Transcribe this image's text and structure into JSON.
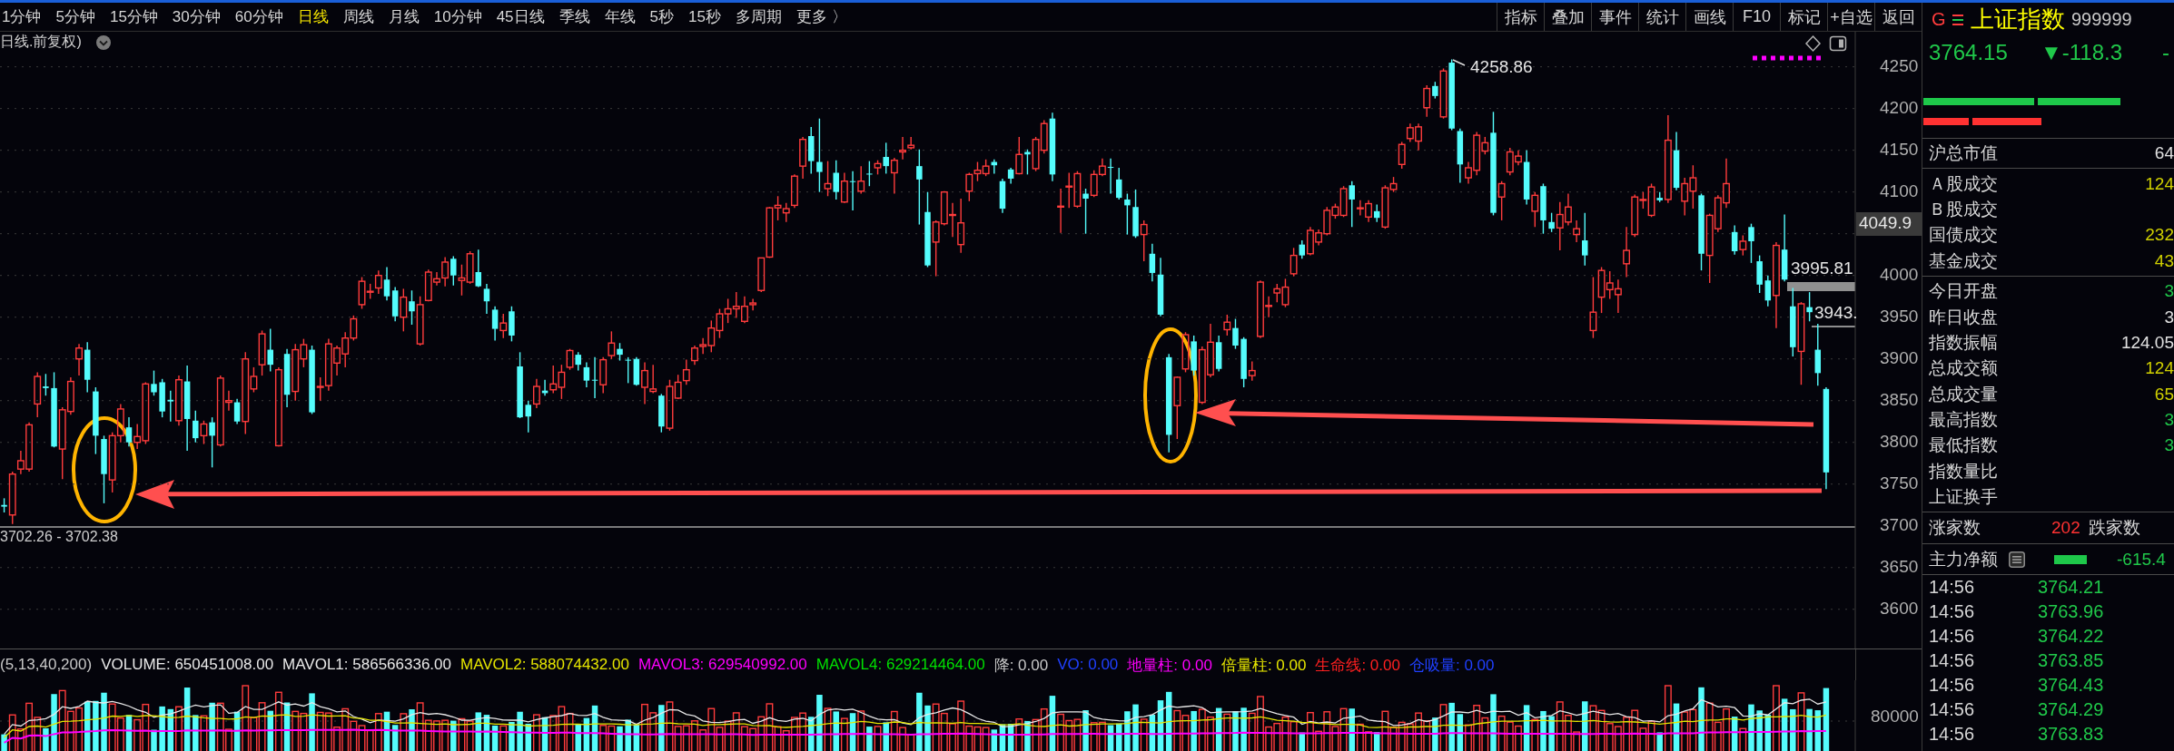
{
  "toolbar": {
    "periods": [
      {
        "label": "1分钟",
        "selected": false
      },
      {
        "label": "5分钟",
        "selected": false
      },
      {
        "label": "15分钟",
        "selected": false
      },
      {
        "label": "30分钟",
        "selected": false
      },
      {
        "label": "60分钟",
        "selected": false
      },
      {
        "label": "日线",
        "selected": true
      },
      {
        "label": "周线",
        "selected": false
      },
      {
        "label": "月线",
        "selected": false
      },
      {
        "label": "10分钟",
        "selected": false
      },
      {
        "label": "45日线",
        "selected": false
      },
      {
        "label": "季线",
        "selected": false
      },
      {
        "label": "年线",
        "selected": false
      },
      {
        "label": "5秒",
        "selected": false
      },
      {
        "label": "15秒",
        "selected": false
      },
      {
        "label": "多周期",
        "selected": false
      },
      {
        "label": "更多 〉",
        "selected": false
      }
    ],
    "tools": [
      "指标",
      "叠加",
      "事件",
      "统计",
      "画线",
      "F10",
      "标记",
      "+自选",
      "返回"
    ]
  },
  "chart": {
    "subtitle": "日线.前复权)",
    "high_label": "4258.86",
    "current_price": "4049.9",
    "price_marks": [
      "3995.81",
      "3943."
    ],
    "low_label": "3702.26 - 3702.38",
    "chart_data": {
      "type": "candlestick",
      "grid": true,
      "ylim": [
        3553,
        4292
      ],
      "yticks": [
        3600,
        3650,
        3700,
        3750,
        3800,
        3850,
        3900,
        3950,
        4000,
        4100,
        4150,
        4200,
        4250
      ],
      "categories": [
        null,
        null,
        null,
        null,
        null,
        null,
        null,
        null,
        null,
        null,
        null,
        null,
        null,
        null,
        null,
        null,
        null,
        null,
        null,
        null,
        null,
        null,
        null,
        null,
        null,
        null,
        null,
        null,
        null,
        null,
        null,
        null,
        null,
        null,
        null,
        null,
        null,
        null,
        null,
        null,
        null,
        null,
        null,
        null,
        null,
        null,
        null,
        null,
        null,
        null,
        null,
        null,
        null,
        null,
        null,
        null,
        null,
        null,
        null,
        null,
        null,
        null,
        null,
        null,
        null,
        null,
        null,
        null,
        null,
        null,
        null,
        null,
        null,
        null,
        null,
        null,
        null,
        null,
        null,
        null,
        null,
        null,
        null,
        null,
        null,
        null,
        null,
        null,
        null,
        null,
        null,
        null,
        null,
        null,
        null,
        null,
        null,
        null,
        null,
        null,
        null,
        null,
        null,
        null,
        null,
        null,
        null,
        null,
        null,
        null,
        null,
        null,
        null,
        null,
        null,
        null,
        null,
        null,
        null,
        null,
        null,
        null,
        null,
        null,
        null,
        null,
        null,
        null,
        null,
        null,
        null,
        null,
        null,
        null,
        null,
        null,
        null,
        null,
        null,
        null,
        null,
        null,
        null,
        null,
        null,
        null,
        null,
        null,
        null,
        null,
        null,
        null,
        null,
        null,
        null,
        null,
        null,
        null,
        null,
        null,
        null,
        null,
        null,
        null,
        null,
        null,
        null,
        null,
        null,
        null,
        null,
        null,
        null,
        null,
        null,
        null,
        null,
        null,
        null,
        null,
        null,
        null,
        null,
        null,
        null,
        null,
        null,
        null,
        null,
        null,
        null,
        null,
        null,
        null,
        null,
        null,
        null,
        null,
        null,
        null,
        null,
        null,
        null,
        null,
        null,
        null,
        null,
        null,
        null,
        null,
        null,
        null,
        null,
        null,
        null,
        null,
        null,
        null,
        null,
        null,
        null,
        null,
        null
      ],
      "ohlc": [
        [
          3725,
          3733,
          3716,
          3723
        ],
        [
          3713,
          3765,
          3702.26,
          3762
        ],
        [
          3768,
          3790,
          3762,
          3778
        ],
        [
          3768,
          3824,
          3765,
          3821
        ],
        [
          3846,
          3884,
          3830,
          3879
        ],
        [
          3867,
          3882,
          3856,
          3865
        ],
        [
          3865,
          3884,
          3794,
          3795
        ],
        [
          3792,
          3842,
          3756,
          3839
        ],
        [
          3837,
          3878,
          3833,
          3873
        ],
        [
          3900,
          3918,
          3880,
          3913
        ],
        [
          3911,
          3920,
          3860,
          3875
        ],
        [
          3861,
          3866,
          3786,
          3808
        ],
        [
          3804,
          3808,
          3727,
          3762
        ],
        [
          3755,
          3812,
          3740,
          3808
        ],
        [
          3808,
          3846,
          3800,
          3840
        ],
        [
          3818,
          3830,
          3795,
          3800
        ],
        [
          3800,
          3822,
          3792,
          3807
        ],
        [
          3802,
          3872,
          3798,
          3870
        ],
        [
          3870,
          3886,
          3856,
          3860
        ],
        [
          3872,
          3876,
          3830,
          3837
        ],
        [
          3851,
          3862,
          3825,
          3849
        ],
        [
          3826,
          3880,
          3820,
          3875
        ],
        [
          3873,
          3892,
          3790,
          3828
        ],
        [
          3826,
          3838,
          3800,
          3805
        ],
        [
          3808,
          3826,
          3798,
          3822
        ],
        [
          3824,
          3830,
          3770,
          3808
        ],
        [
          3797,
          3880,
          3795,
          3877
        ],
        [
          3848,
          3862,
          3838,
          3850
        ],
        [
          3848,
          3852,
          3822,
          3825
        ],
        [
          3825,
          3908,
          3810,
          3900
        ],
        [
          3864,
          3890,
          3860,
          3879
        ],
        [
          3893,
          3934,
          3880,
          3930
        ],
        [
          3911,
          3936,
          3885,
          3893
        ],
        [
          3796,
          3890,
          3795,
          3887
        ],
        [
          3906,
          3912,
          3842,
          3857
        ],
        [
          3861,
          3918,
          3850,
          3911
        ],
        [
          3900,
          3924,
          3890,
          3917
        ],
        [
          3911,
          3916,
          3834,
          3836
        ],
        [
          3866,
          3878,
          3850,
          3867
        ],
        [
          3868,
          3924,
          3862,
          3918
        ],
        [
          3895,
          3916,
          3880,
          3913
        ],
        [
          3906,
          3932,
          3890,
          3925
        ],
        [
          3925,
          3952,
          3922,
          3948
        ],
        [
          3965,
          3998,
          3960,
          3993
        ],
        [
          3980,
          3990,
          3972,
          3981
        ],
        [
          3985,
          4006,
          3978,
          4000
        ],
        [
          3995,
          4010,
          3970,
          3975
        ],
        [
          3982,
          3986,
          3945,
          3951
        ],
        [
          3950,
          3984,
          3933,
          3974
        ],
        [
          3969,
          3982,
          3941,
          3957
        ],
        [
          3918,
          3975,
          3916,
          3965
        ],
        [
          3970,
          4007,
          3969,
          4004
        ],
        [
          3992,
          4004,
          3988,
          3996
        ],
        [
          3997,
          4022,
          3987,
          4016
        ],
        [
          4020,
          4023,
          3988,
          4000
        ],
        [
          3994,
          4013,
          3976,
          3997
        ],
        [
          3992,
          4029,
          3990,
          4026
        ],
        [
          4004,
          4031,
          3986,
          3987
        ],
        [
          3984,
          3990,
          3954,
          3969
        ],
        [
          3959,
          3963,
          3922,
          3936
        ],
        [
          3934,
          3954,
          3925,
          3943
        ],
        [
          3957,
          3963,
          3921,
          3928
        ],
        [
          3891,
          3908,
          3829,
          3830
        ],
        [
          3845,
          3850,
          3812,
          3831
        ],
        [
          3846,
          3876,
          3841,
          3867
        ],
        [
          3862,
          3875,
          3856,
          3859
        ],
        [
          3863,
          3892,
          3859,
          3870
        ],
        [
          3866,
          3893,
          3852,
          3884
        ],
        [
          3890,
          3912,
          3887,
          3910
        ],
        [
          3905,
          3908,
          3886,
          3893
        ],
        [
          3890,
          3896,
          3866,
          3874
        ],
        [
          3875,
          3902,
          3853,
          3874
        ],
        [
          3869,
          3902,
          3859,
          3899
        ],
        [
          3904,
          3933,
          3900,
          3919
        ],
        [
          3912,
          3919,
          3898,
          3905
        ],
        [
          3899,
          3902,
          3871,
          3898
        ],
        [
          3900,
          3902,
          3868,
          3869
        ],
        [
          3866,
          3896,
          3846,
          3886
        ],
        [
          3861,
          3893,
          3859,
          3864
        ],
        [
          3856,
          3858,
          3812,
          3819
        ],
        [
          3817,
          3875,
          3814,
          3867
        ],
        [
          3853,
          3881,
          3852,
          3872
        ],
        [
          3874,
          3899,
          3869,
          3887
        ],
        [
          3898,
          3916,
          3893,
          3913
        ],
        [
          3915,
          3925,
          3906,
          3917
        ],
        [
          3916,
          3946,
          3908,
          3937
        ],
        [
          3934,
          3960,
          3925,
          3954
        ],
        [
          3954,
          3972,
          3943,
          3960
        ],
        [
          3960,
          3980,
          3949,
          3963
        ],
        [
          3945,
          3975,
          3943,
          3963
        ],
        [
          3965,
          3972,
          3958,
          3967
        ],
        [
          3982,
          4021,
          3980,
          4021
        ],
        [
          4022,
          4082,
          4021,
          4081
        ],
        [
          4081,
          4095,
          4066,
          4084
        ],
        [
          4075,
          4087,
          4064,
          4080
        ],
        [
          4084,
          4121,
          4081,
          4119
        ],
        [
          4131,
          4166,
          4116,
          4163
        ],
        [
          4167,
          4178,
          4122,
          4137
        ],
        [
          4136,
          4188,
          4100,
          4124
        ],
        [
          4104,
          4137,
          4095,
          4110
        ],
        [
          4123,
          4138,
          4091,
          4100
        ],
        [
          4088,
          4123,
          4087,
          4113
        ],
        [
          4113,
          4125,
          4078,
          4112
        ],
        [
          4101,
          4131,
          4098,
          4113
        ],
        [
          4122,
          4137,
          4107,
          4121
        ],
        [
          4129,
          4138,
          4121,
          4134
        ],
        [
          4142,
          4159,
          4122,
          4131
        ],
        [
          4123,
          4141,
          4098,
          4138
        ],
        [
          4148,
          4166,
          4139,
          4150
        ],
        [
          4153,
          4166,
          4151,
          4156
        ],
        [
          4131,
          4151,
          4061,
          4115
        ],
        [
          4076,
          4100,
          4010,
          4012
        ],
        [
          4040,
          4066,
          3999,
          4064
        ],
        [
          4062,
          4101,
          4060,
          4100
        ],
        [
          4072,
          4087,
          4046,
          4073
        ],
        [
          4037,
          4092,
          4027,
          4063
        ],
        [
          4101,
          4123,
          4089,
          4121
        ],
        [
          4122,
          4136,
          4113,
          4126
        ],
        [
          4122,
          4139,
          4119,
          4131
        ],
        [
          4136,
          4139,
          4122,
          4132
        ],
        [
          4113,
          4116,
          4075,
          4080
        ],
        [
          4127,
          4129,
          4110,
          4116
        ],
        [
          4122,
          4166,
          4121,
          4145
        ],
        [
          4148,
          4151,
          4121,
          4145
        ],
        [
          4128,
          4166,
          4125,
          4163
        ],
        [
          4150,
          4186,
          4146,
          4182
        ],
        [
          4188,
          4195,
          4113,
          4121
        ],
        [
          4083,
          4104,
          4051,
          4083
        ],
        [
          4107,
          4123,
          4081,
          4107
        ],
        [
          4083,
          4125,
          4081,
          4122
        ],
        [
          4098,
          4104,
          4050,
          4092
        ],
        [
          4096,
          4126,
          4094,
          4121
        ],
        [
          4121,
          4140,
          4119,
          4131
        ],
        [
          4130,
          4140,
          4098,
          4129
        ],
        [
          4115,
          4129,
          4091,
          4093
        ],
        [
          4091,
          4098,
          4049,
          4084
        ],
        [
          4082,
          4103,
          4045,
          4047
        ],
        [
          4049,
          4066,
          4017,
          4061
        ],
        [
          4026,
          4038,
          3993,
          4003
        ],
        [
          4001,
          4021,
          3951,
          3953
        ],
        [
          3902,
          3906,
          3788,
          3809
        ],
        [
          3844,
          3879,
          3804,
          3878
        ],
        [
          3888,
          3932,
          3884,
          3929
        ],
        [
          3921,
          3928,
          3880,
          3886
        ],
        [
          3848,
          3915,
          3846,
          3911
        ],
        [
          3881,
          3942,
          3878,
          3920
        ],
        [
          3920,
          3928,
          3885,
          3888
        ],
        [
          3935,
          3953,
          3928,
          3944
        ],
        [
          3937,
          3948,
          3912,
          3916
        ],
        [
          3924,
          3926,
          3866,
          3876
        ],
        [
          3880,
          3897,
          3874,
          3886
        ],
        [
          3927,
          3994,
          3925,
          3992
        ],
        [
          3963,
          3975,
          3950,
          3964
        ],
        [
          3979,
          3990,
          3968,
          3984
        ],
        [
          3965,
          3996,
          3962,
          3986
        ],
        [
          4002,
          4033,
          3999,
          4024
        ],
        [
          4037,
          4042,
          4020,
          4024
        ],
        [
          4026,
          4058,
          4024,
          4054
        ],
        [
          4040,
          4055,
          4036,
          4051
        ],
        [
          4050,
          4082,
          4048,
          4078
        ],
        [
          4072,
          4086,
          4068,
          4082
        ],
        [
          4072,
          4107,
          4070,
          4104
        ],
        [
          4108,
          4113,
          4058,
          4091
        ],
        [
          4080,
          4090,
          4072,
          4081
        ],
        [
          4070,
          4090,
          4064,
          4086
        ],
        [
          4077,
          4085,
          4064,
          4069
        ],
        [
          4058,
          4108,
          4056,
          4105
        ],
        [
          4103,
          4118,
          4100,
          4110
        ],
        [
          4133,
          4160,
          4128,
          4157
        ],
        [
          4164,
          4182,
          4160,
          4177
        ],
        [
          4161,
          4182,
          4150,
          4178
        ],
        [
          4201,
          4228,
          4190,
          4224
        ],
        [
          4227,
          4232,
          4212,
          4215
        ],
        [
          4190,
          4248,
          4188,
          4245
        ],
        [
          4255,
          4258.86,
          4174,
          4176
        ],
        [
          4173,
          4176,
          4111,
          4133
        ],
        [
          4117,
          4136,
          4110,
          4129
        ],
        [
          4126,
          4172,
          4120,
          4168
        ],
        [
          4149,
          4166,
          4145,
          4159
        ],
        [
          4171,
          4196,
          4072,
          4075
        ],
        [
          4094,
          4113,
          4066,
          4110
        ],
        [
          4124,
          4153,
          4120,
          4148
        ],
        [
          4136,
          4150,
          4132,
          4143
        ],
        [
          4136,
          4150,
          4085,
          4091
        ],
        [
          4077,
          4100,
          4058,
          4096
        ],
        [
          4107,
          4110,
          4050,
          4066
        ],
        [
          4064,
          4075,
          4052,
          4056
        ],
        [
          4057,
          4088,
          4030,
          4073
        ],
        [
          4064,
          4098,
          4060,
          4082
        ],
        [
          4049,
          4066,
          4040,
          4056
        ],
        [
          4042,
          4075,
          4012,
          4024
        ],
        [
          3934,
          3998,
          3925,
          3956
        ],
        [
          3974,
          4010,
          3955,
          4006
        ],
        [
          3983,
          4005,
          3972,
          3991
        ],
        [
          3977,
          3995,
          3955,
          3984
        ],
        [
          4014,
          4058,
          3998,
          4030
        ],
        [
          4049,
          4097,
          4046,
          4094
        ],
        [
          4090,
          4100,
          4080,
          4091
        ],
        [
          4072,
          4110,
          4070,
          4106
        ],
        [
          4093,
          4100,
          4088,
          4090
        ],
        [
          4091,
          4192,
          4087,
          4162
        ],
        [
          4150,
          4172,
          4102,
          4105
        ],
        [
          4089,
          4117,
          4072,
          4110
        ],
        [
          4101,
          4132,
          4080,
          4117
        ],
        [
          4096,
          4098,
          4006,
          4026
        ],
        [
          4024,
          4074,
          3991,
          4072
        ],
        [
          4056,
          4096,
          4052,
          4093
        ],
        [
          4087,
          4140,
          4081,
          4110
        ],
        [
          4052,
          4060,
          4025,
          4029
        ],
        [
          4031,
          4048,
          4024,
          4041
        ],
        [
          4058,
          4062,
          4015,
          4041
        ],
        [
          4017,
          4024,
          3979,
          3989
        ],
        [
          3994,
          4000,
          3963,
          3970
        ],
        [
          3976,
          4040,
          3937,
          4036
        ],
        [
          4031,
          4073,
          3993,
          3995
        ],
        [
          3963,
          3985,
          3903,
          3914
        ],
        [
          3909,
          3968,
          3869,
          3966
        ],
        [
          3962,
          3980,
          3945,
          3956
        ],
        [
          3911,
          3942,
          3868,
          3883
        ],
        [
          3864,
          3866,
          3744,
          3764
        ],
        null,
        null,
        null
      ]
    }
  },
  "volume": {
    "legend": [
      {
        "text": "(5,13,40,200)",
        "color": "#c8c8c8"
      },
      {
        "text": "VOLUME: 650451008.00",
        "color": "#e8e8e8"
      },
      {
        "text": "MAVOL1: 586566336.00",
        "color": "#e8e8e8"
      },
      {
        "text": "MAVOL2: 588074432.00",
        "color": "#e6e600"
      },
      {
        "text": "MAVOL3: 629540992.00",
        "color": "#ff00ff"
      },
      {
        "text": "MAVOL4: 629214464.00",
        "color": "#00e000"
      },
      {
        "text": "降: 0.00",
        "color": "#c8c8c8"
      },
      {
        "text": "VO: 0.00",
        "color": "#2040ff"
      },
      {
        "text": "地量柱: 0.00",
        "color": "#ff00ff"
      },
      {
        "text": "倍量柱: 0.00",
        "color": "#e6e600"
      },
      {
        "text": "生命线: 0.00",
        "color": "#ff2020"
      },
      {
        "text": "仓吸量: 0.00",
        "color": "#2040ff"
      }
    ],
    "y_axis_labels": [
      "80000"
    ]
  },
  "quote": {
    "market_mark": "G",
    "name": "上证指数",
    "code": "999999",
    "price": "3764.15",
    "change": "▼-118.3",
    "change_percent": "-",
    "stat_groups": [
      {
        "rows": [
          {
            "label": "沪总市值",
            "value": "64",
            "color": "#e0e0e0"
          }
        ]
      },
      {
        "rows": [
          {
            "label": "Ａ股成交",
            "value": "124",
            "color": "#d0d000"
          },
          {
            "label": "Ｂ股成交"
          },
          {
            "label": "国债成交",
            "value": "232",
            "color": "#d0d000"
          },
          {
            "label": "基金成交",
            "value": "43",
            "color": "#d0d000"
          }
        ]
      },
      {
        "rows": [
          {
            "label": "今日开盘",
            "value": "3",
            "color": "#20c84a"
          },
          {
            "label": "昨日收盘",
            "value": "3",
            "color": "#e0e0e0"
          },
          {
            "label": "指数振幅",
            "value": "124.05",
            "color": "#e0e0e0"
          },
          {
            "label": "总成交额",
            "value": "124",
            "color": "#d0d000"
          },
          {
            "label": "总成交量",
            "value": "65",
            "color": "#d0d000"
          },
          {
            "label": "最高指数",
            "value": "3",
            "color": "#20c84a"
          },
          {
            "label": "最低指数",
            "value": "3",
            "color": "#20c84a"
          },
          {
            "label": "指数量比"
          },
          {
            "label": "上证换手"
          }
        ]
      }
    ],
    "breadth": {
      "advancers_label": "涨家数",
      "advancers": "202",
      "decliners_label": "跌家数"
    },
    "main_flow": {
      "label": "主力净额",
      "value": "-615.4"
    },
    "ticks": [
      {
        "time": "14:56",
        "price": "3764.21"
      },
      {
        "time": "14:56",
        "price": "3763.96"
      },
      {
        "time": "14:56",
        "price": "3764.22"
      },
      {
        "time": "14:56",
        "price": "3763.85"
      },
      {
        "time": "14:56",
        "price": "3764.43"
      },
      {
        "time": "14:56",
        "price": "3764.29"
      },
      {
        "time": "14:56",
        "price": "3763.83"
      }
    ]
  }
}
